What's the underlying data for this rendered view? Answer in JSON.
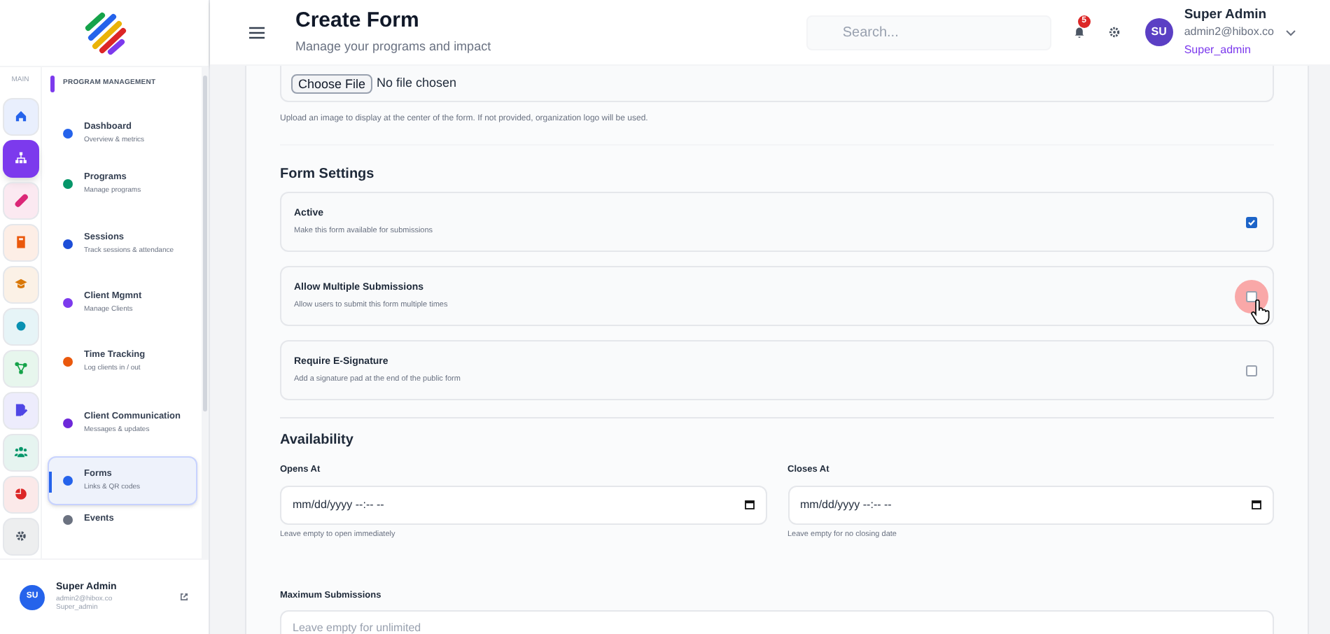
{
  "sidebar": {
    "rail_label": "MAIN",
    "rail": [
      {
        "color": "#2563eb",
        "selected": false
      },
      {
        "color": "#7c3aed",
        "selected": true
      },
      {
        "color": "#db2777",
        "selected": false
      },
      {
        "color": "#ea580c",
        "selected": false
      },
      {
        "color": "#d97706",
        "selected": false
      },
      {
        "color": "#0891b2",
        "selected": false
      },
      {
        "color": "#16a34a",
        "selected": false
      },
      {
        "color": "#4f46e5",
        "selected": false
      },
      {
        "color": "#059669",
        "selected": false
      },
      {
        "color": "#dc2626",
        "selected": false
      },
      {
        "color": "#4b5563",
        "selected": false
      }
    ],
    "section_title": "PROGRAM MANAGEMENT",
    "items": [
      {
        "title": "Dashboard",
        "subtitle": "Overview & metrics",
        "color": "#2563eb",
        "selected": false
      },
      {
        "title": "Programs",
        "subtitle": "Manage programs",
        "color": "#059669",
        "selected": false
      },
      {
        "title": "Sessions",
        "subtitle": "Track sessions & attendance",
        "color": "#1d4ed8",
        "selected": false
      },
      {
        "title": "Client Mgmnt",
        "subtitle": "Manage Clients",
        "color": "#7c3aed",
        "selected": false
      },
      {
        "title": "Time Tracking",
        "subtitle": "Log clients in / out",
        "color": "#ea580c",
        "selected": false
      },
      {
        "title": "Client Communication",
        "subtitle": "Messages & updates",
        "color": "#6d28d9",
        "selected": false
      },
      {
        "title": "Forms",
        "subtitle": "Links & QR codes",
        "color": "#2563eb",
        "selected": true
      },
      {
        "title": "Events",
        "color": "#6b7280",
        "selected": false
      }
    ],
    "user": {
      "initials": "SU",
      "name": "Super Admin",
      "email": "admin2@hibox.co",
      "role": "Super_admin"
    }
  },
  "header": {
    "title": "Create Form",
    "subtitle": "Manage your programs and impact",
    "search": {
      "placeholder": "Search..."
    },
    "notifications": "5",
    "user": {
      "initials": "SU",
      "name": "Super Admin",
      "email": "admin2@hibox.co",
      "role": "Super_admin"
    }
  },
  "file_upload": {
    "button": "Choose File",
    "value": "No file chosen",
    "hint": "Upload an image to display at the center of the form. If not provided, organization logo will be used."
  },
  "form_settings": {
    "title": "Form Settings",
    "options": [
      {
        "label": "Active",
        "description": "Make this form available for submissions",
        "checked": true,
        "focused": false
      },
      {
        "label": "Allow Multiple Submissions",
        "description": "Allow users to submit this form multiple times",
        "checked": false,
        "focused": true
      },
      {
        "label": "Require E-Signature",
        "description": "Add a signature pad at the end of the public form",
        "checked": false,
        "focused": false
      }
    ]
  },
  "availability": {
    "title": "Availability",
    "fields": [
      {
        "label": "Opens At",
        "value": "mm/dd/yyyy --:-- --",
        "hint": "Leave empty to open immediately"
      },
      {
        "label": "Closes At",
        "value": "mm/dd/yyyy --:-- --",
        "hint": "Leave empty for no closing date"
      }
    ],
    "max_submissions": {
      "label": "Maximum Submissions",
      "placeholder": "Leave empty for unlimited"
    }
  }
}
